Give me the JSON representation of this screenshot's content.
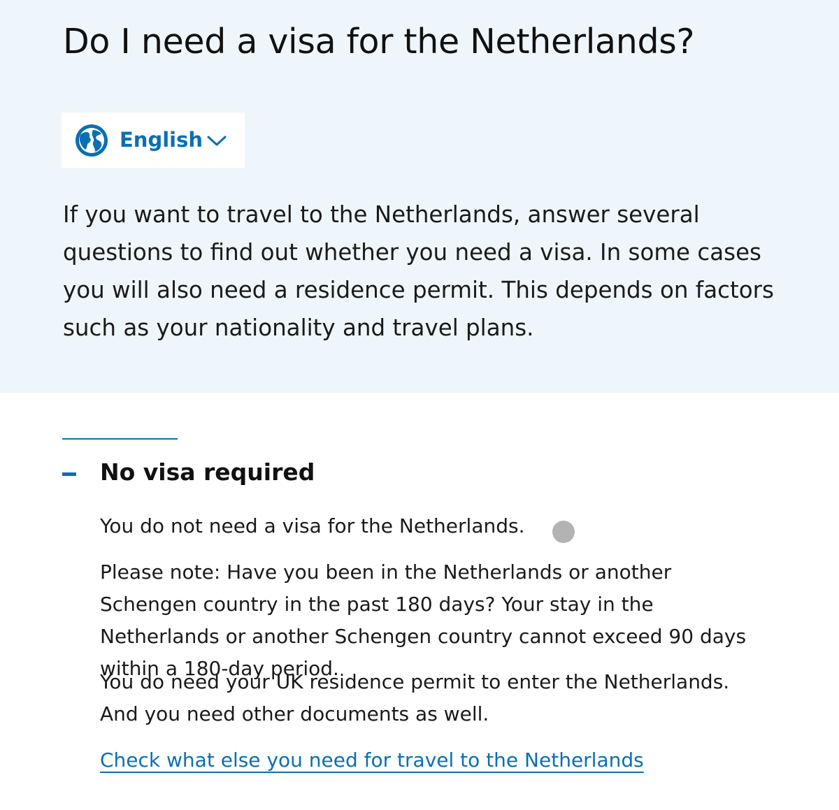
{
  "page": {
    "title": "Do I need a visa for the Netherlands?"
  },
  "language_selector": {
    "label": "English",
    "icon": "globe-icon",
    "dropdown_icon": "chevron-down-icon"
  },
  "intro": {
    "text": "If you want to travel to the Netherlands, answer several questions to find out whether you need a visa. In some cases you will also need a residence permit. This depends on factors such as your nationality and travel plans."
  },
  "result": {
    "toggle_icon": "minus-icon",
    "title": "No visa required",
    "paragraphs": [
      "You do not need a visa for the Netherlands.",
      "Please note: Have you been in the Netherlands or another Schengen country in the past 180 days? Your stay in the Netherlands or another Schengen country cannot exceed 90 days within a 180-day period.",
      "You do need your UK residence permit to enter the Netherlands. And you need other documents as well."
    ],
    "link_text": "Check what else you need for travel to the Netherlands"
  },
  "colors": {
    "accent": "#0a6fb3",
    "hero_background": "#eef6fb",
    "text": "#1a1a1a"
  }
}
